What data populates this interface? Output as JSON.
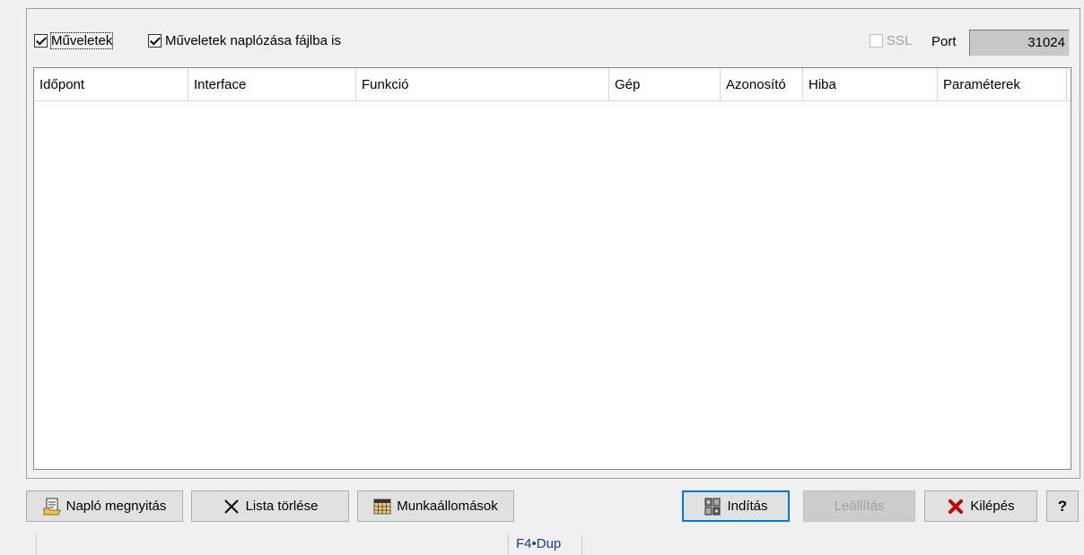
{
  "options": {
    "muveletek_label": "Műveletek",
    "naplozas_label": "Műveletek naplózása fájlba is",
    "ssl_label": "SSL",
    "port_label": "Port",
    "port_value": "31024"
  },
  "columns": [
    "Időpont",
    "Interface",
    "Funkció",
    "Gép",
    "Azonosító",
    "Hiba",
    "Paraméterek"
  ],
  "rows": [],
  "buttons": {
    "naplo": "Napló megnyitás",
    "lista": "Lista törlése",
    "munka": "Munkaállomások",
    "inditas": "Indítás",
    "leallitas": "Leállítás",
    "kilepes": "Kilépés",
    "help": "?"
  },
  "icons": {
    "naplo": "open-log-icon",
    "lista": "clear-x-icon",
    "munka": "calendar-grid-icon",
    "inditas": "start-server-icon",
    "kilepes": "red-x-icon"
  },
  "status_bar": {
    "hotkey": "F4•Dup"
  },
  "colors": {
    "accent": "#0078d7",
    "exit_x": "#c00000",
    "status_text": "#1a3c8c"
  }
}
